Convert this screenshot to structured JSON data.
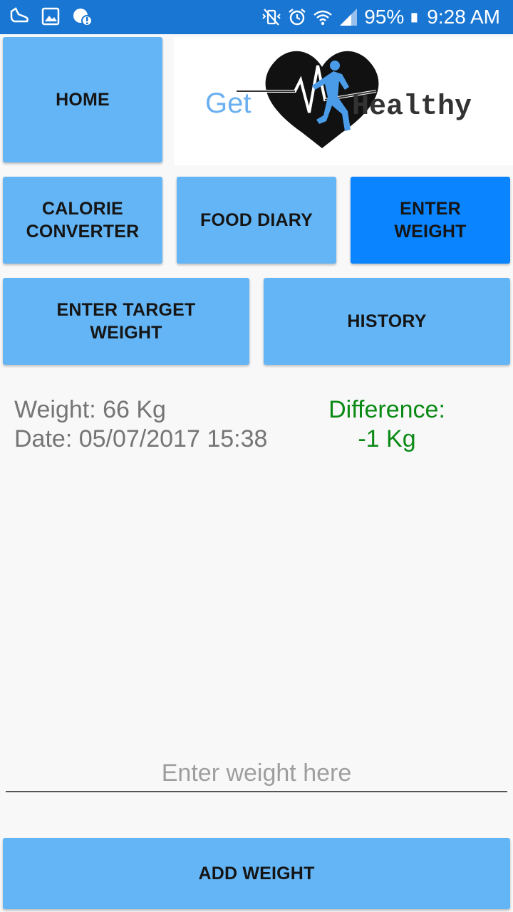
{
  "status_bar": {
    "battery": "95%",
    "time": "9:28 AM",
    "left_icons": [
      "notification-shoe-icon",
      "gallery-icon",
      "alert-icon"
    ],
    "right_icons": [
      "vibrate-mute-icon",
      "alarm-icon",
      "wifi-icon",
      "signal-icon",
      "battery-icon"
    ]
  },
  "nav": {
    "home": "HOME",
    "calorie_converter": "CALORIE\nCONVERTER",
    "food_diary": "FOOD DIARY",
    "enter_weight": "ENTER\nWEIGHT",
    "enter_target_weight": "ENTER TARGET\nWEIGHT",
    "history": "HISTORY"
  },
  "logo": {
    "word1": "Get",
    "word2": "Healthy"
  },
  "entry": {
    "weight": "Weight: 66 Kg",
    "date": "Date: 05/07/2017 15:38",
    "difference_label": "Difference:",
    "difference_value": "-1 Kg"
  },
  "input": {
    "placeholder": "Enter weight here",
    "value": ""
  },
  "actions": {
    "add_weight": "ADD WEIGHT"
  },
  "colors": {
    "status_bar": "#1976d2",
    "button": "#64b5f6",
    "button_active": "#0a84ff",
    "difference_text": "#0a8a14"
  }
}
